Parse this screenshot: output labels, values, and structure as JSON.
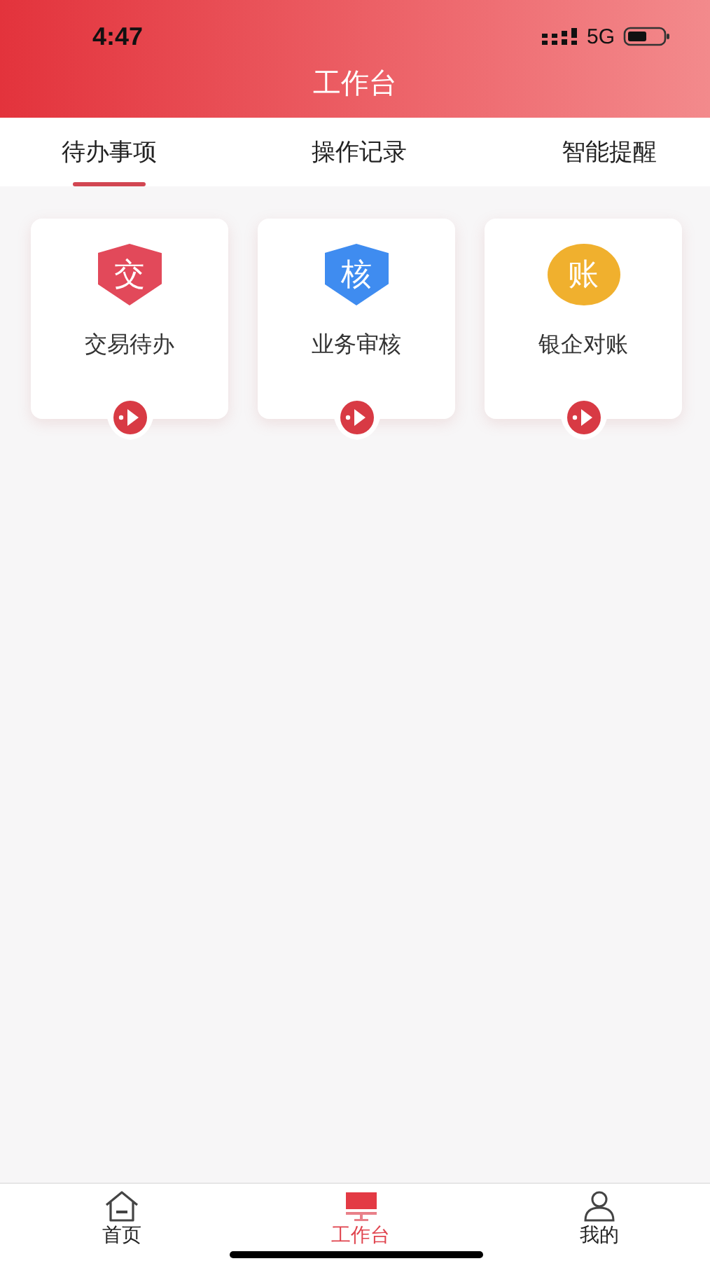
{
  "status_bar": {
    "time": "4:47",
    "network": "5G"
  },
  "header": {
    "title": "工作台"
  },
  "tabs": [
    {
      "label": "待办事项",
      "selected": true
    },
    {
      "label": "操作记录",
      "selected": false
    },
    {
      "label": "智能提醒",
      "selected": false
    }
  ],
  "cards": [
    {
      "badge": "交",
      "label": "交易待办",
      "kind": "shield",
      "color": "#e2495a"
    },
    {
      "badge": "核",
      "label": "业务审核",
      "kind": "shield",
      "color": "#3f8cf0"
    },
    {
      "badge": "账",
      "label": "银企对账",
      "kind": "coin",
      "color": "#f0b02e"
    }
  ],
  "bottom_nav": [
    {
      "label": "首页",
      "kind": "home",
      "selected": false
    },
    {
      "label": "工作台",
      "kind": "monitor",
      "selected": true
    },
    {
      "label": "我的",
      "kind": "person",
      "selected": false
    }
  ]
}
